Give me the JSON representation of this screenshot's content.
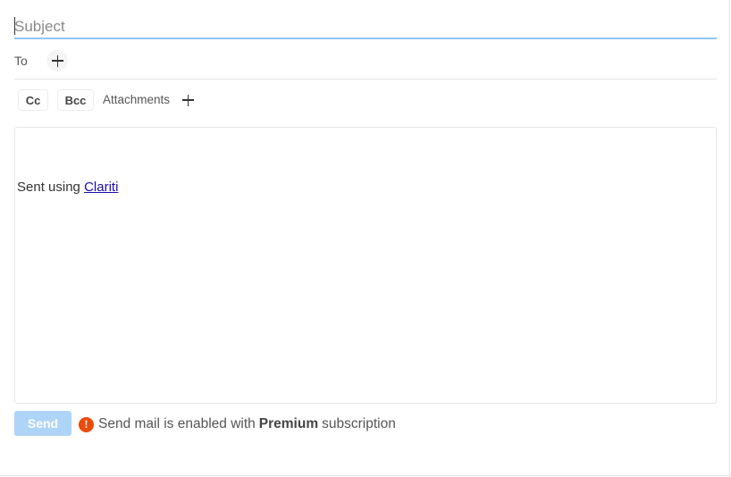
{
  "compose": {
    "subject": {
      "placeholder": "Subject",
      "value": ""
    },
    "to": {
      "label": "To",
      "add_icon": "plus-icon"
    },
    "cc_label": "Cc",
    "bcc_label": "Bcc",
    "attachments": {
      "label": "Attachments",
      "add_icon": "plus-icon"
    },
    "body": {
      "signature_prefix": "Sent using",
      "signature_link": "Clariti"
    },
    "send_label": "Send",
    "notice": {
      "icon": "alert-icon",
      "text_before": "Send mail is enabled with",
      "text_bold": "Premium",
      "text_after": "subscription"
    }
  },
  "colors": {
    "accent_underline": "#90c4f5",
    "send_disabled": "#aed4f7",
    "alert": "#ec4a0a",
    "link": "#1a0dab"
  }
}
